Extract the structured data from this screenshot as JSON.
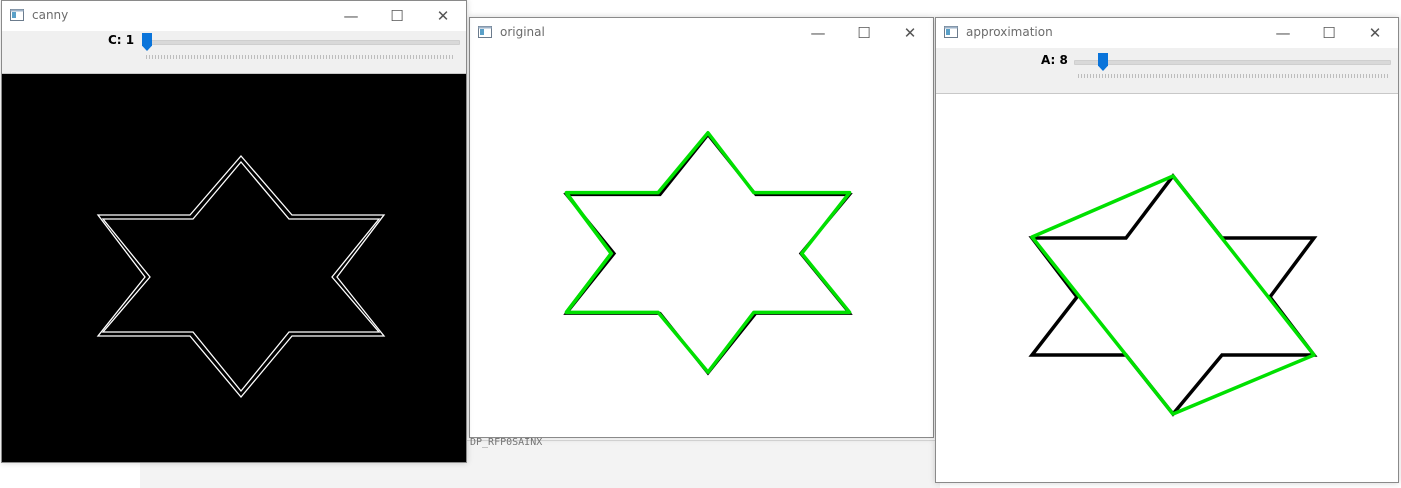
{
  "windows": {
    "canny": {
      "title": "canny",
      "slider": {
        "label": "C: 1",
        "value": 1,
        "position": 0.0
      },
      "image": "canny-edge-star-outline"
    },
    "original": {
      "title": "original",
      "image": "star-with-green-contour"
    },
    "approximation": {
      "title": "approximation",
      "slider": {
        "label": "A: 8",
        "value": 8,
        "position": 0.08
      },
      "image": "star-with-green-polygon-approximation"
    }
  },
  "window_controls": {
    "minimize": "—",
    "maximize": "☐",
    "close": "✕"
  },
  "background_fragment": "DP_RFP0SAINX",
  "colors": {
    "contour": "#00e000",
    "shape": "#000000",
    "slider_thumb": "#0a74da",
    "canny_background": "#000000",
    "canny_edge": "#ffffff"
  }
}
